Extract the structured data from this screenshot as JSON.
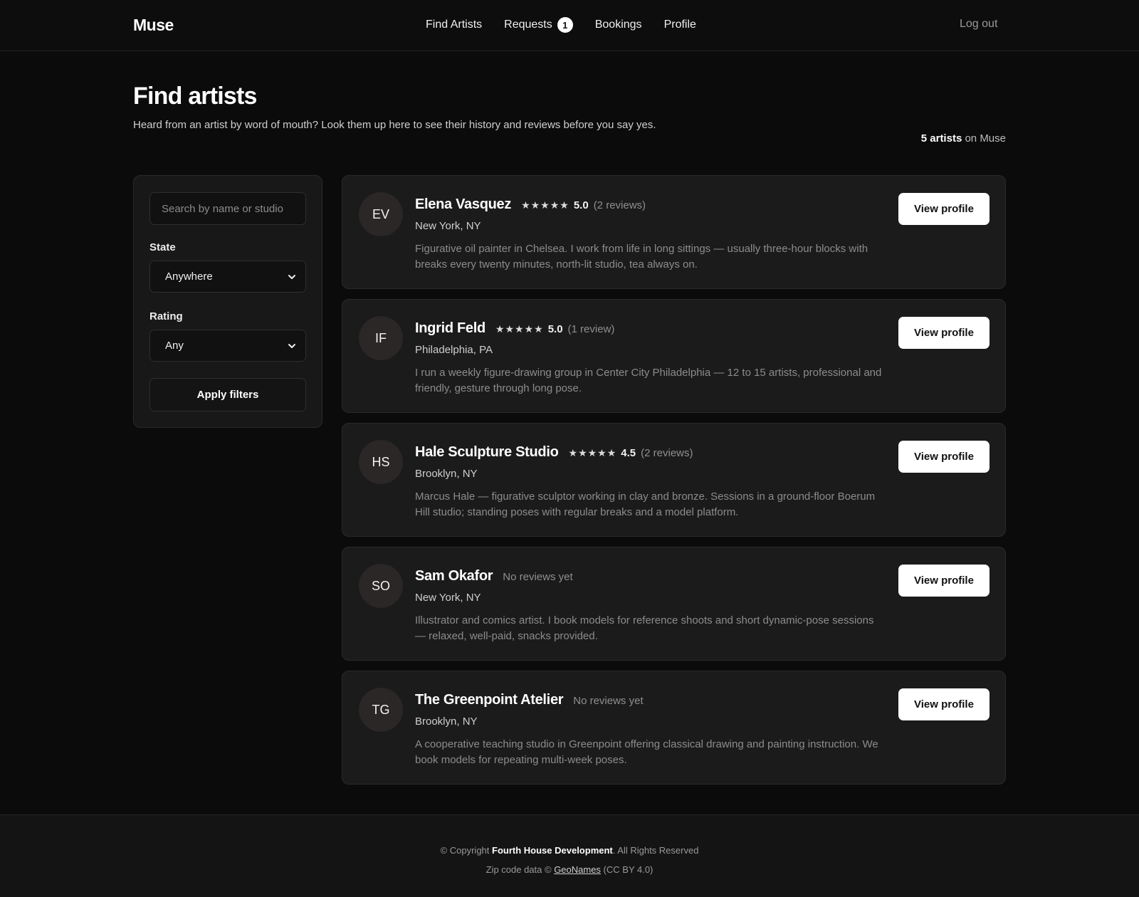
{
  "header": {
    "logo": "Muse",
    "nav": [
      {
        "label": "Find Artists"
      },
      {
        "label": "Requests",
        "badge": "1"
      },
      {
        "label": "Bookings"
      },
      {
        "label": "Profile"
      }
    ],
    "logout": "Log out"
  },
  "page": {
    "title": "Find artists",
    "subtitle": "Heard from an artist by word of mouth? Look them up here to see their history and reviews before you say yes.",
    "count_number": "5 artists",
    "count_suffix": " on Muse"
  },
  "filters": {
    "search_placeholder": "Search by name or studio",
    "state_label": "State",
    "state_value": "Anywhere",
    "rating_label": "Rating",
    "rating_value": "Any",
    "apply_label": "Apply filters"
  },
  "artists": [
    {
      "initials": "EV",
      "name": "Elena Vasquez",
      "stars": "★★★★★",
      "rating": "5.0",
      "reviews": "(2 reviews)",
      "location": "New York, NY",
      "description": "Figurative oil painter in Chelsea. I work from life in long sittings — usually three-hour blocks with breaks every twenty minutes, north-lit studio, tea always on.",
      "button": "View profile"
    },
    {
      "initials": "IF",
      "name": "Ingrid Feld",
      "stars": "★★★★★",
      "rating": "5.0",
      "reviews": "(1 review)",
      "location": "Philadelphia, PA",
      "description": "I run a weekly figure-drawing group in Center City Philadelphia — 12 to 15 artists, professional and friendly, gesture through long pose.",
      "button": "View profile"
    },
    {
      "initials": "HS",
      "name": "Hale Sculpture Studio",
      "stars": "★★★★★",
      "rating": "4.5",
      "reviews": "(2 reviews)",
      "location": "Brooklyn, NY",
      "description": "Marcus Hale — figurative sculptor working in clay and bronze. Sessions in a ground-floor Boerum Hill studio; standing poses with regular breaks and a model platform.",
      "button": "View profile"
    },
    {
      "initials": "SO",
      "name": "Sam Okafor",
      "no_reviews": "No reviews yet",
      "location": "New York, NY",
      "description": "Illustrator and comics artist. I book models for reference shoots and short dynamic-pose sessions — relaxed, well-paid, snacks provided.",
      "button": "View profile"
    },
    {
      "initials": "TG",
      "name": "The Greenpoint Atelier",
      "no_reviews": "No reviews yet",
      "location": "Brooklyn, NY",
      "description": "A cooperative teaching studio in Greenpoint offering classical drawing and painting instruction. We book models for repeating multi-week poses.",
      "button": "View profile"
    }
  ],
  "footer": {
    "copyright_prefix": "© Copyright ",
    "company": "Fourth House Development",
    "copyright_suffix": ". All Rights Reserved",
    "zip_prefix": "Zip code data © ",
    "zip_link": "GeoNames",
    "zip_suffix": " (CC BY 4.0)"
  }
}
